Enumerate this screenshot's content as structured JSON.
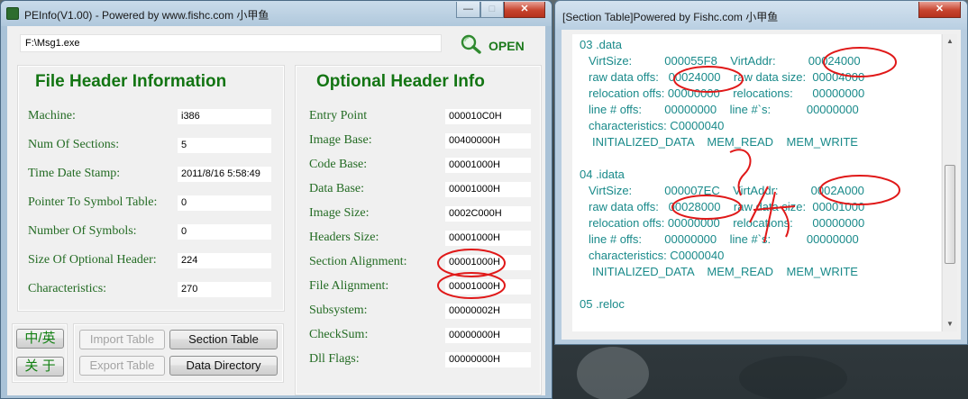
{
  "pe_window": {
    "title": "PEInfo(V1.00) - Powered by www.fishc.com 小甲鱼",
    "controls": {
      "minimize": "—",
      "maximize": "□",
      "close": "✕"
    },
    "file_path": "F:\\Msg1.exe",
    "open_label": "OPEN",
    "file_header": {
      "title": "File Header Information",
      "fields": [
        {
          "label": "Machine:",
          "value": "i386"
        },
        {
          "label": "Num Of Sections:",
          "value": "5"
        },
        {
          "label": "Time Date Stamp:",
          "value": "2011/8/16 5:58:49"
        },
        {
          "label": "Pointer To Symbol Table:",
          "value": "0"
        },
        {
          "label": "Number Of Symbols:",
          "value": "0"
        },
        {
          "label": "Size Of Optional Header:",
          "value": "224"
        },
        {
          "label": "Characteristics:",
          "value": "270"
        }
      ]
    },
    "optional_header": {
      "title": "Optional Header Info",
      "fields": [
        {
          "label": "Entry Point",
          "value": "000010C0H"
        },
        {
          "label": "Image Base:",
          "value": "00400000H"
        },
        {
          "label": "Code Base:",
          "value": "00001000H"
        },
        {
          "label": "Data Base:",
          "value": "00001000H"
        },
        {
          "label": "Image Size:",
          "value": "0002C000H"
        },
        {
          "label": "Headers Size:",
          "value": "00001000H"
        },
        {
          "label": "Section Alignment:",
          "value": "00001000H"
        },
        {
          "label": "File Alignment:",
          "value": "00001000H"
        },
        {
          "label": "Subsystem:",
          "value": "00000002H"
        },
        {
          "label": "CheckSum:",
          "value": "00000000H"
        },
        {
          "label": "Dll Flags:",
          "value": "00000000H"
        }
      ]
    },
    "buttons": {
      "lang": "中/英",
      "about": "关 于",
      "import_table": "Import Table",
      "section_table": "Section Table",
      "export_table": "Export Table",
      "data_directory": "Data Directory"
    }
  },
  "section_window": {
    "title": "[Section Table]Powered by Fishc.com 小甲鱼",
    "close": "✕",
    "lines": [
      "03 .data",
      "VirtSize:          000055F8    VirtAddr:          00024000",
      "raw data offs:   00024000    raw data size:  00004000",
      "relocation offs: 00000000    relocations:      00000000",
      "line # offs:       00000000    line #`s:           00000000",
      "characteristics: C0000040",
      "INITIALIZED_DATA    MEM_READ    MEM_WRITE",
      "04 .idata",
      "VirtSize:          000007EC    VirtAddr:          0002A000",
      "raw data offs:   00028000    raw data size:  00001000",
      "relocation offs: 00000000    relocations:      00000000",
      "line # offs:       00000000    line #`s:           00000000",
      "characteristics: C0000040",
      "INITIALIZED_DATA    MEM_READ    MEM_WRITE",
      "05 .reloc"
    ]
  },
  "colors": {
    "label_green": "#236b23",
    "title_green": "#137513",
    "section_text": "#198a8a",
    "ink_red": "#e01818"
  }
}
